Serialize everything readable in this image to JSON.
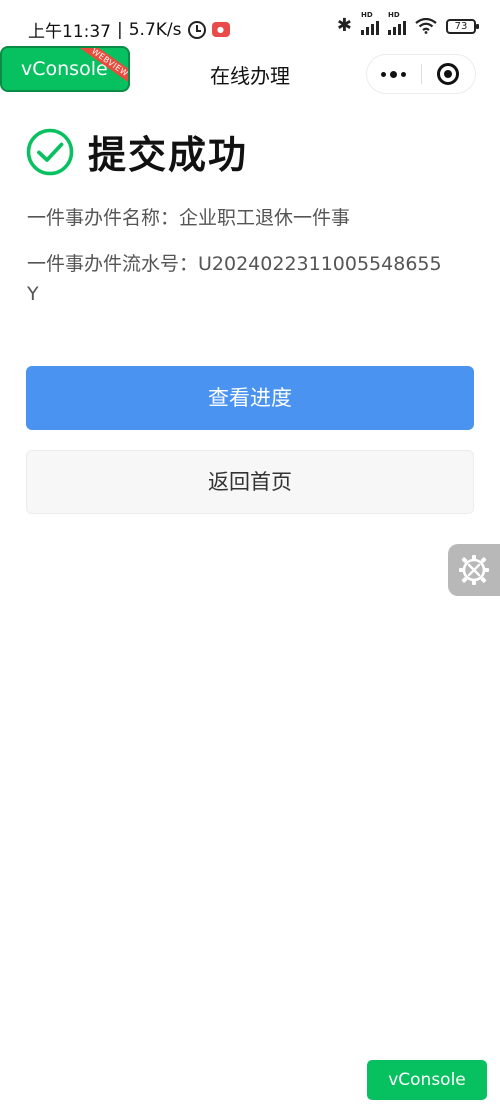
{
  "status_bar": {
    "time": "上午11:37",
    "speed": "5.7K/s",
    "battery": "73",
    "signal_label": "HD",
    "separator": "|"
  },
  "nav": {
    "title": "在线办理"
  },
  "vconsole": {
    "top_label": "vConsole",
    "ribbon": "WEBVIEW",
    "bottom_label": "vConsole"
  },
  "result": {
    "title": "提交成功",
    "name_line": "一件事办件名称：企业职工退休一件事",
    "serial_line": "一件事办件流水号：U2024022311005548655Y"
  },
  "buttons": {
    "progress": "查看进度",
    "home": "返回首页"
  },
  "colors": {
    "success": "#07c160",
    "primary": "#4a93f0"
  }
}
